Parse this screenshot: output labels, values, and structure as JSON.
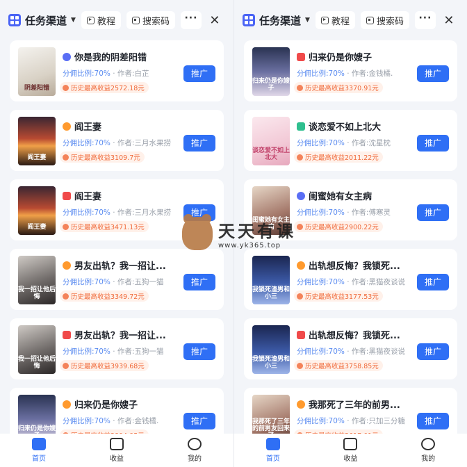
{
  "screens": [
    {
      "header": {
        "channel": "任务渠道",
        "tutorial": "教程",
        "search_code": "搜索码",
        "more": "···",
        "close": "✕"
      },
      "books": [
        {
          "title": "你是我的阴差阳错",
          "badge": "b-blue",
          "cover_text": "阴差阳错",
          "cover": "c-light",
          "rate_label": "分佣比例:",
          "rate": "70%",
          "author_label": "作者:",
          "author": "白芷",
          "income": "历史最高收益2572.18元",
          "action": "推广"
        },
        {
          "title": "阎王妻",
          "badge": "b-orange",
          "cover_text": "阎王妻",
          "cover": "c-sunset",
          "rate_label": "分佣比例:",
          "rate": "70%",
          "author_label": "作者:",
          "author": "三月水果捞",
          "income": "历史最高收益3109.7元",
          "action": "推广"
        },
        {
          "title": "阎王妻",
          "badge": "b-red",
          "cover_text": "阎王妻",
          "cover": "c-sunset",
          "rate_label": "分佣比例:",
          "rate": "70%",
          "author_label": "作者:",
          "author": "三月水果捞",
          "income": "历史最高收益3471.13元",
          "action": "推广"
        },
        {
          "title": "男友出轨？我一招让...",
          "badge": "b-orange",
          "cover_text": "我一招让他后悔",
          "cover": "c-dark",
          "rate_label": "分佣比例:",
          "rate": "70%",
          "author_label": "作者:",
          "author": "五狗一猫",
          "income": "历史最高收益3349.72元",
          "action": "推广"
        },
        {
          "title": "男友出轨？我一招让...",
          "badge": "b-red",
          "cover_text": "我一招让他后悔",
          "cover": "c-dark",
          "rate_label": "分佣比例:",
          "rate": "70%",
          "author_label": "作者:",
          "author": "五狗一猫",
          "income": "历史最高收益3939.68元",
          "action": "推广"
        },
        {
          "title": "归来仍是你嫂子",
          "badge": "b-orange",
          "cover_text": "归来仍是你嫂子",
          "cover": "c-night",
          "rate_label": "分佣比例:",
          "rate": "70%",
          "author_label": "作者:",
          "author": "金钱橘.",
          "income": "历史最高收益3894.95元",
          "action": "推广"
        }
      ],
      "tabs": [
        {
          "label": "首页",
          "active": true
        },
        {
          "label": "收益",
          "active": false
        },
        {
          "label": "我的",
          "active": false
        }
      ]
    },
    {
      "header": {
        "channel": "任务渠道",
        "tutorial": "教程",
        "search_code": "搜索码",
        "more": "···",
        "close": "✕"
      },
      "books": [
        {
          "title": "归来仍是你嫂子",
          "badge": "b-red",
          "cover_text": "归来仍是你嫂子",
          "cover": "c-night",
          "rate_label": "分佣比例:",
          "rate": "70%",
          "author_label": "作者:",
          "author": "金钱橘.",
          "income": "历史最高收益3370.91元",
          "action": "推广"
        },
        {
          "title": "谈恋爱不如上北大",
          "badge": "b-green",
          "cover_text": "谈恋爱不如上北大",
          "cover": "c-pink",
          "rate_label": "分佣比例:",
          "rate": "70%",
          "author_label": "作者:",
          "author": "沈星枕",
          "income": "历史最高收益2011.22元",
          "action": "推广"
        },
        {
          "title": "闺蜜她有女主病",
          "badge": "b-blue",
          "cover_text": "闺蜜她有女主病",
          "cover": "c-warm",
          "rate_label": "分佣比例:",
          "rate": "70%",
          "author_label": "作者:",
          "author": "傅寒灵",
          "income": "历史最高收益2900.22元",
          "action": "推广"
        },
        {
          "title": "出轨想反悔？我锁死...",
          "badge": "b-orange",
          "cover_text": "我锁死渣男和小三",
          "cover": "c-blue",
          "rate_label": "分佣比例:",
          "rate": "70%",
          "author_label": "作者:",
          "author": "黑猫夜谈说",
          "income": "历史最高收益3177.53元",
          "action": "推广"
        },
        {
          "title": "出轨想反悔？我锁死...",
          "badge": "b-red",
          "cover_text": "我锁死渣男和小三",
          "cover": "c-blue",
          "rate_label": "分佣比例:",
          "rate": "70%",
          "author_label": "作者:",
          "author": "黑猫夜谈说",
          "income": "历史最高收益3758.85元",
          "action": "推广"
        },
        {
          "title": "我那死了三年的前男...",
          "badge": "b-orange",
          "cover_text": "我那死了三年的前男友回来了",
          "cover": "c-warm",
          "rate_label": "分佣比例:",
          "rate": "70%",
          "author_label": "作者:",
          "author": "只加三分糖",
          "income": "历史最高收益3617.01元",
          "action": "推广"
        }
      ],
      "tabs": [
        {
          "label": "首页",
          "active": true
        },
        {
          "label": "收益",
          "active": false
        },
        {
          "label": "我的",
          "active": false
        }
      ]
    }
  ],
  "watermark": {
    "title": "天天有课",
    "url": "www.yk365.top"
  }
}
